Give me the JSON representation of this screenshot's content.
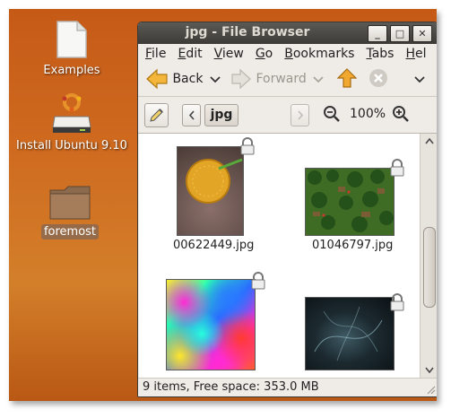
{
  "desktop": {
    "icons": [
      {
        "label": "Examples"
      },
      {
        "label": "Install Ubuntu 9.10"
      },
      {
        "label": "foremost"
      }
    ]
  },
  "window": {
    "title": "jpg - File Browser",
    "controls": {
      "minimize": "_",
      "maximize": "□",
      "close": "✕"
    }
  },
  "menubar": [
    "File",
    "Edit",
    "View",
    "Go",
    "Bookmarks",
    "Tabs",
    "Hel"
  ],
  "toolbar": {
    "back_label": "Back",
    "forward_label": "Forward"
  },
  "pathbar": {
    "current_folder": "jpg",
    "zoom_level": "100%"
  },
  "files": [
    {
      "name": "00622449.jpg"
    },
    {
      "name": "01046797.jpg"
    },
    {
      "name": ""
    },
    {
      "name": ""
    }
  ],
  "status": {
    "text": "9 items, Free space: 353.0 MB"
  },
  "colors": {
    "desktop_orange": "#cf6a1f",
    "title_bar": "#3c3b37",
    "window_bg": "#efebe7",
    "up_arrow": "#f0a830"
  }
}
